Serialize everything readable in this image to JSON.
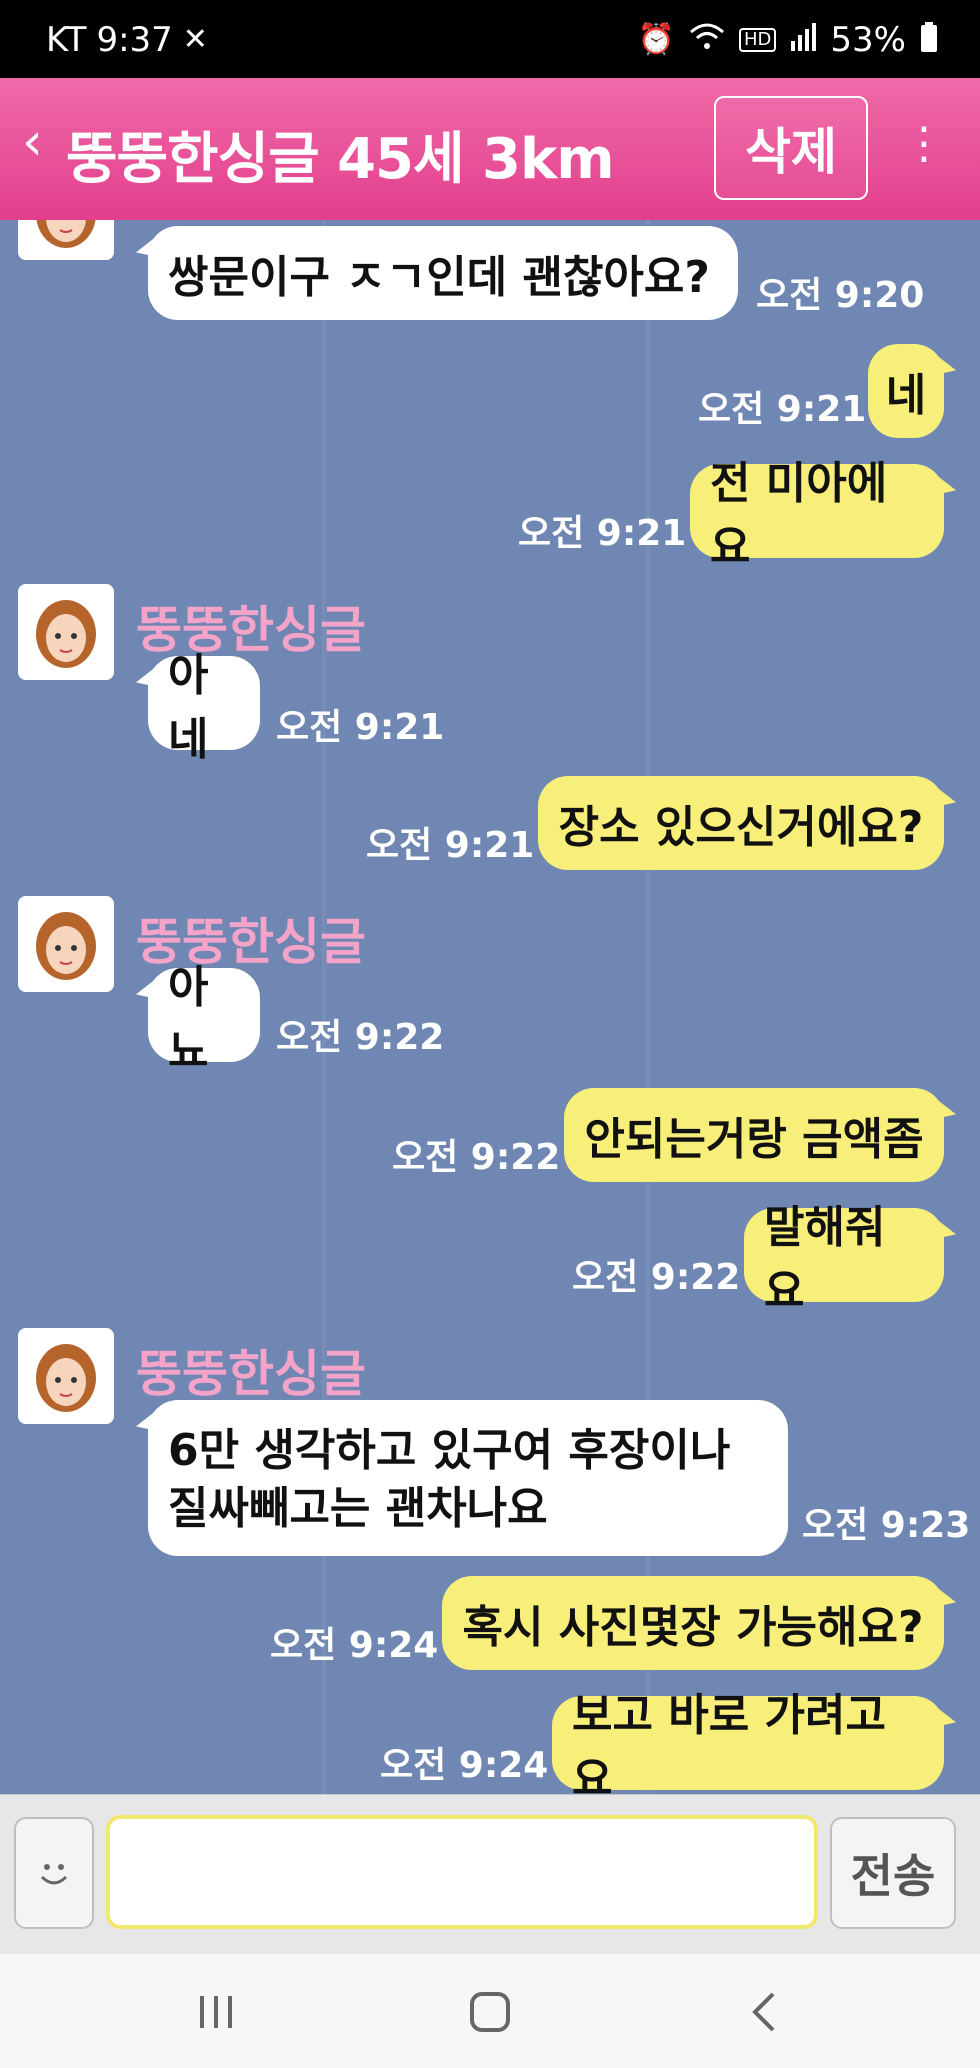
{
  "status_bar": {
    "carrier": "KT",
    "time": "9:37",
    "battery": "53%",
    "icons": [
      "silent-icon",
      "alarm-icon",
      "wifi-icon",
      "hd-icon",
      "signal-icon",
      "battery-icon"
    ]
  },
  "header": {
    "title": "뚱뚱한싱글 45세 3km",
    "delete_label": "삭제",
    "back_icon": "chevron-left-icon",
    "more_icon": "more-vertical-icon",
    "color": "#e8508f"
  },
  "chat": {
    "background": "#6f87b2",
    "messages": [
      {
        "dir": "in",
        "text": "쌍문이구 ㅈㄱ인데 괜찮아요?",
        "time": "오전 9:20"
      },
      {
        "dir": "out",
        "text": "네",
        "time": "오전 9:21"
      },
      {
        "dir": "out",
        "text": "전 미아에요",
        "time": "오전 9:21"
      },
      {
        "dir": "in",
        "sender": "뚱뚱한싱글",
        "text": "아네",
        "time": "오전 9:21"
      },
      {
        "dir": "out",
        "text": "장소 있으신거에요?",
        "time": "오전 9:21"
      },
      {
        "dir": "in",
        "sender": "뚱뚱한싱글",
        "text": "아뇨",
        "time": "오전 9:22"
      },
      {
        "dir": "out",
        "text": "안되는거랑 금액좀",
        "time": "오전 9:22"
      },
      {
        "dir": "out",
        "text": "말해줘요",
        "time": "오전 9:22"
      },
      {
        "dir": "in",
        "sender": "뚱뚱한싱글",
        "text_lines": [
          "6만 생각하고 있구여 후장이나",
          "질싸빼고는 괜차나요"
        ],
        "time": "오전 9:23"
      },
      {
        "dir": "out",
        "text": "혹시 사진몇장 가능해요?",
        "time": "오전 9:24"
      },
      {
        "dir": "out",
        "text": "보고 바로 가려고요",
        "time": "오전 9:24"
      }
    ]
  },
  "input": {
    "value": "",
    "emoji_icon": "smiley-icon",
    "send_label": "전송"
  },
  "nav": {
    "recent_icon": "recent-apps-icon",
    "home_icon": "home-icon",
    "back_icon": "back-icon"
  }
}
